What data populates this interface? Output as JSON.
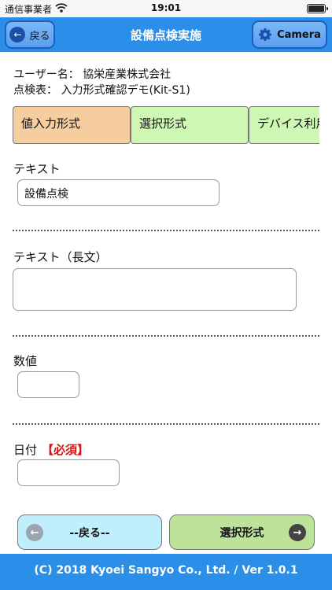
{
  "status": {
    "carrier": "通信事業者",
    "time": "19:01"
  },
  "nav": {
    "title": "設備点検実施",
    "back_label": "戻る",
    "camera_label": "Camera"
  },
  "info": {
    "user": "ユーザー名： 協栄産業株式会社",
    "sheet": "点検表： 入力形式確認デモ(Kit-S1)"
  },
  "tabs": [
    {
      "label": "値入力形式"
    },
    {
      "label": "選択形式"
    },
    {
      "label": "デバイス利用"
    }
  ],
  "fields": {
    "text_label": "テキスト",
    "text_value": "設備点検",
    "long_label": "テキスト（長文）",
    "long_value": "",
    "number_label": "数値",
    "number_value": "",
    "date_label": "日付",
    "date_required": "【必須】",
    "date_value": ""
  },
  "buttons": {
    "prev": "--戻る--",
    "next": "選択形式"
  },
  "footer": "(C) 2018 Kyoei Sangyo Co., Ltd. / Ver 1.0.1",
  "colors": {
    "accent": "#2b8ee8",
    "tab_active": "#f5cd9e",
    "tab_inactive": "#cff7b4",
    "required": "#dd1111"
  }
}
